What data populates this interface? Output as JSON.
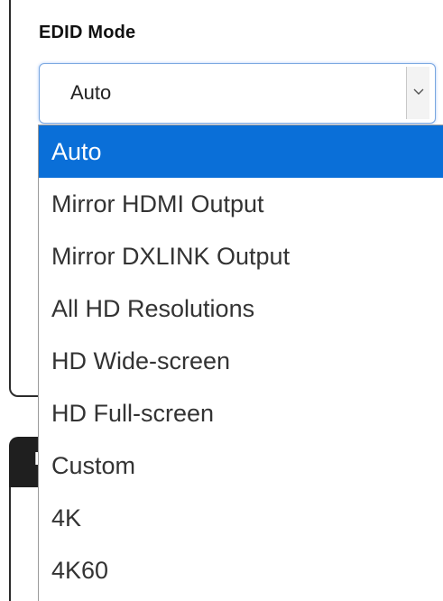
{
  "edid_section": {
    "label": "EDID Mode",
    "select": {
      "value": "Auto",
      "arrow_icon": "chevron-down-icon"
    },
    "options": [
      {
        "label": "Auto",
        "selected": true
      },
      {
        "label": "Mirror HDMI Output",
        "selected": false
      },
      {
        "label": "Mirror DXLINK Output",
        "selected": false
      },
      {
        "label": "All HD Resolutions",
        "selected": false
      },
      {
        "label": "HD Wide-screen",
        "selected": false
      },
      {
        "label": "HD Full-screen",
        "selected": false
      },
      {
        "label": "Custom",
        "selected": false
      },
      {
        "label": "4K",
        "selected": false
      },
      {
        "label": "4K60",
        "selected": false
      }
    ]
  },
  "second_panel": {
    "header_text": "H"
  },
  "colors": {
    "selected_option_bg": "#0a6fd8",
    "select_focus_border": "#7aa7e0",
    "panel_header_bg": "#1f1f1f"
  }
}
